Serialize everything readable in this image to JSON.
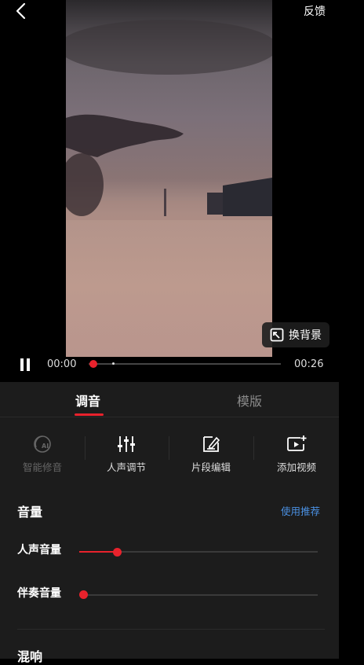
{
  "header": {
    "back_icon": "back-chevron-icon",
    "feedback_label": "反馈"
  },
  "video": {
    "replace_bg_label": "换背景",
    "replace_bg_icon": "replace-background-icon"
  },
  "player": {
    "current_time": "00:00",
    "duration": "00:26",
    "state": "playing",
    "progress": 0.0
  },
  "tabs": [
    {
      "label": "调音",
      "active": true
    },
    {
      "label": "模版",
      "active": false
    }
  ],
  "tools": [
    {
      "label": "智能修音",
      "icon": "ai-tune-icon",
      "enabled": false
    },
    {
      "label": "人声调节",
      "icon": "equalizer-sliders-icon",
      "enabled": true
    },
    {
      "label": "片段编辑",
      "icon": "edit-clip-icon",
      "enabled": true
    },
    {
      "label": "添加视频",
      "icon": "add-video-icon",
      "enabled": true
    }
  ],
  "volume": {
    "title": "音量",
    "recommend_label": "使用推荐",
    "vocal": {
      "label": "人声音量",
      "value": 0.16
    },
    "accompaniment": {
      "label": "伴奏音量",
      "value": 0.0
    }
  },
  "reverb": {
    "title": "混响"
  },
  "colors": {
    "accent": "#e8222c",
    "link": "#4a90e2",
    "panel_bg": "#1c1c1c"
  }
}
